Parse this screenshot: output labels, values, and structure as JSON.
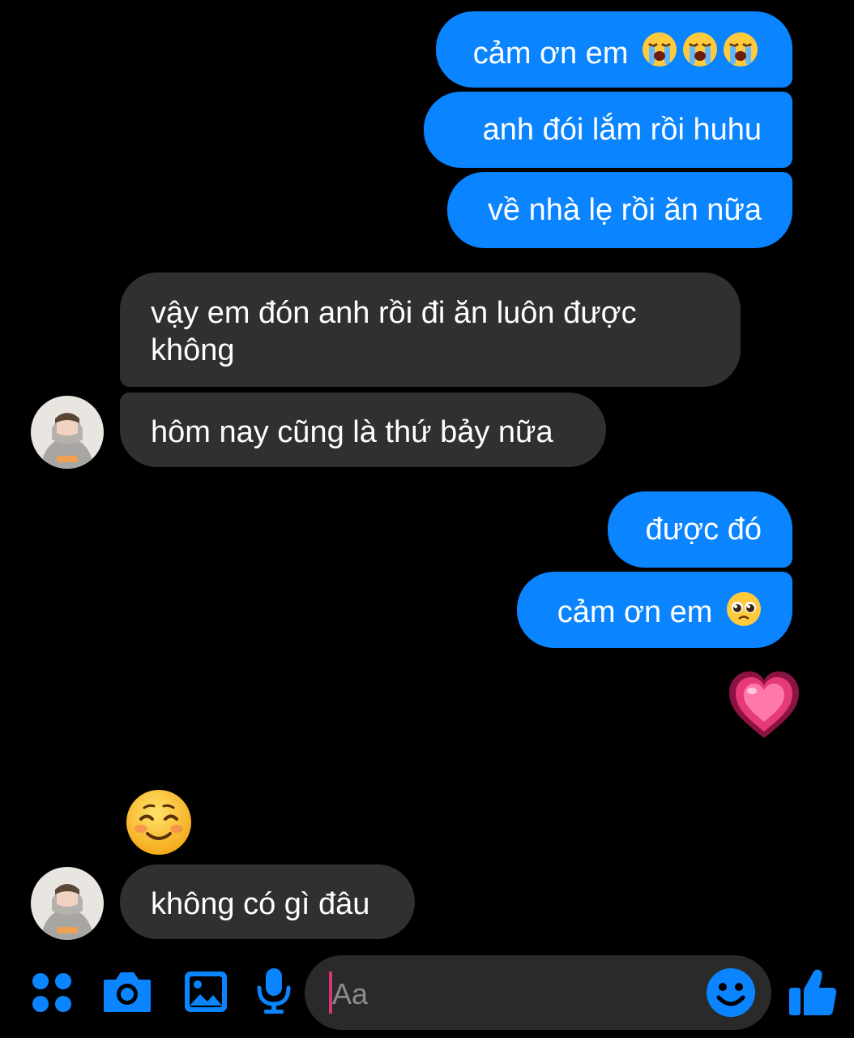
{
  "messages": [
    {
      "side": "sent",
      "text": "cảm ơn em",
      "emoji": "loudly-crying-face x3"
    },
    {
      "side": "sent",
      "text": "anh đói lắm rồi huhu"
    },
    {
      "side": "sent",
      "text": "về nhà lẹ rồi ăn nữa"
    },
    {
      "side": "received",
      "text": "vậy em đón anh rồi đi ăn luôn được không"
    },
    {
      "side": "received",
      "text": "hôm nay cũng là thứ bảy nữa"
    },
    {
      "side": "sent",
      "text": "được đó"
    },
    {
      "side": "sent",
      "text": "cảm ơn em",
      "emoji": "pleading-face"
    },
    {
      "side": "sent",
      "emoji": "growing-heart"
    },
    {
      "side": "received",
      "emoji": "smiling-face"
    },
    {
      "side": "received",
      "text": "không có gì đâu"
    }
  ],
  "composer": {
    "placeholder": "Aa",
    "icons": [
      "menu-dots-icon",
      "camera-icon",
      "gallery-icon",
      "microphone-icon",
      "emoji-icon",
      "thumbs-up-icon"
    ]
  },
  "colors": {
    "sent_bubble": "#0a84ff",
    "received_bubble": "#303030",
    "background": "#000000",
    "icon_accent": "#0a84ff"
  }
}
